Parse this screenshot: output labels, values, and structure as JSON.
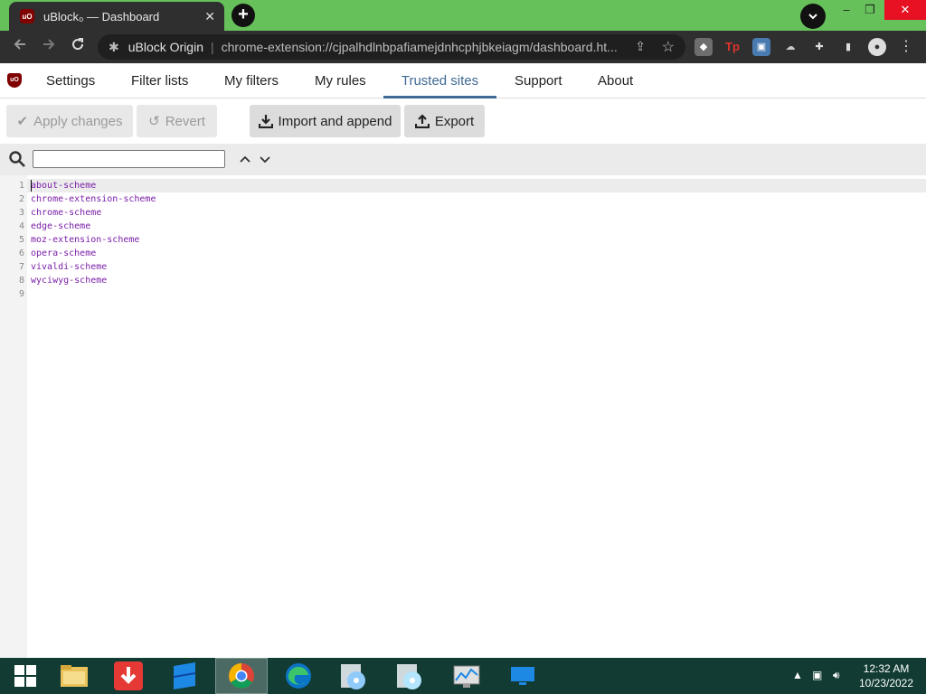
{
  "browser": {
    "tab_title": "uBlock₀ — Dashboard",
    "tab_close": "✕",
    "new_tab": "+",
    "omnibox_site": "uBlock Origin",
    "omnibox_separator": "|",
    "omnibox_url": "chrome-extension://cjpalhdlnbpafiamejdnhcphjbkeiagm/dashboard.ht...",
    "window_minimize": "–",
    "window_restore": "❐",
    "window_close": "✕"
  },
  "ubo_nav": {
    "tabs": [
      "Settings",
      "Filter lists",
      "My filters",
      "My rules",
      "Trusted sites",
      "Support",
      "About"
    ],
    "active_tab": "Trusted sites"
  },
  "actions": {
    "apply_label": "Apply changes",
    "revert_label": "Revert",
    "import_label": "Import and append",
    "export_label": "Export"
  },
  "search": {
    "value": "",
    "placeholder": ""
  },
  "editor": {
    "line_numbers": [
      "1",
      "2",
      "3",
      "4",
      "5",
      "6",
      "7",
      "8",
      "9"
    ],
    "lines": [
      "about-scheme",
      "chrome-extension-scheme",
      "chrome-scheme",
      "edge-scheme",
      "moz-extension-scheme",
      "opera-scheme",
      "vivaldi-scheme",
      "wyciwyg-scheme",
      ""
    ]
  },
  "taskbar": {
    "time": "12:32 AM",
    "date": "10/23/2022"
  },
  "colors": {
    "accent": "#3f6a94",
    "code_text": "#7a1ea8",
    "taskbar": "#113b33",
    "titlebar": "#66c15a"
  }
}
